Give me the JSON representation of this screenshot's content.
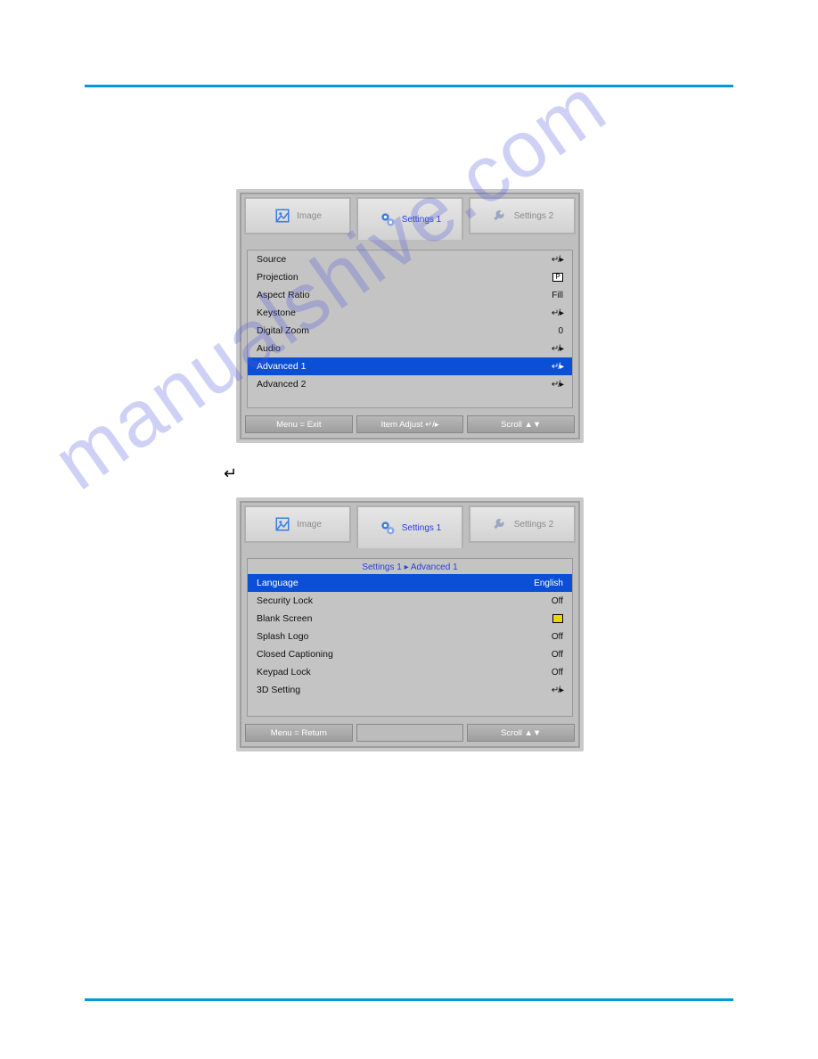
{
  "watermark": "manualshive.com",
  "tabs": {
    "image": "Image",
    "settings1": "Settings 1",
    "settings2": "Settings 2"
  },
  "panel1": {
    "rows": [
      {
        "label": "Source",
        "value": "↵/▸",
        "type": "enter"
      },
      {
        "label": "Projection",
        "value": "P",
        "type": "pbox"
      },
      {
        "label": "Aspect Ratio",
        "value": "Fill",
        "type": "text"
      },
      {
        "label": "Keystone",
        "value": "↵/▸",
        "type": "enter"
      },
      {
        "label": "Digital Zoom",
        "value": "0",
        "type": "text"
      },
      {
        "label": "Audio",
        "value": "↵/▸",
        "type": "enter"
      },
      {
        "label": "Advanced 1",
        "value": "↵/▸",
        "type": "enter",
        "selected": true
      },
      {
        "label": "Advanced 2",
        "value": "↵/▸",
        "type": "enter"
      }
    ],
    "footer": {
      "left": "Menu = Exit",
      "mid": "Item Adjust ↵/▸",
      "right": "Scroll ▲▼"
    }
  },
  "panel2": {
    "crumb": "Settings 1 ▸ Advanced 1",
    "rows": [
      {
        "label": "Language",
        "value": "English",
        "type": "text",
        "selected": true
      },
      {
        "label": "Security Lock",
        "value": "Off",
        "type": "text"
      },
      {
        "label": "Blank Screen",
        "value": "",
        "type": "colorbox"
      },
      {
        "label": "Splash Logo",
        "value": "Off",
        "type": "text"
      },
      {
        "label": "Closed Captioning",
        "value": "Off",
        "type": "text"
      },
      {
        "label": "Keypad Lock",
        "value": "Off",
        "type": "text"
      },
      {
        "label": "3D Setting",
        "value": "↵/▸",
        "type": "enter"
      }
    ],
    "footer": {
      "left": "Menu = Return",
      "mid": "",
      "right": "Scroll ▲▼"
    }
  }
}
